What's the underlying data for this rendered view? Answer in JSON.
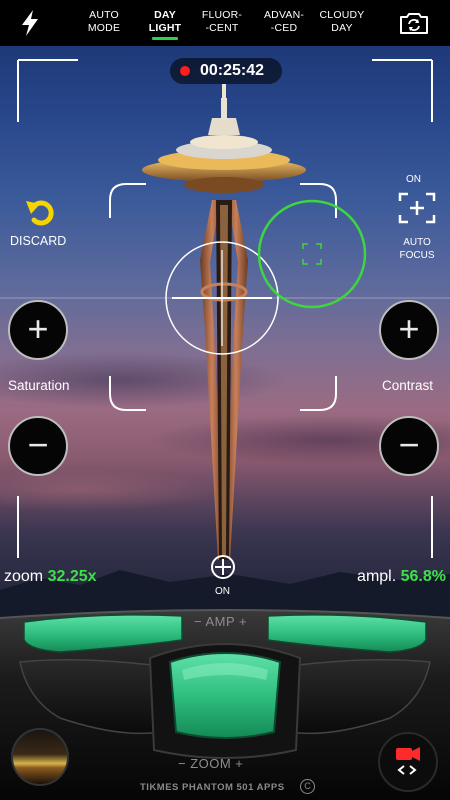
{
  "top_bar": {
    "flash_icon": "lightning-bolt-icon",
    "camera_switch_icon": "camera-switch-icon",
    "modes": [
      {
        "line1": "AUTO",
        "line2": "MODE",
        "active": false
      },
      {
        "line1": "DAY",
        "line2": "LIGHT",
        "active": true
      },
      {
        "line1": "FLUOR-",
        "line2": "-CENT",
        "active": false
      },
      {
        "line1": "ADVAN-",
        "line2": "-CED",
        "active": false
      },
      {
        "line1": "CLOUDY",
        "line2": "DAY",
        "active": false
      }
    ],
    "active_color": "#2bd24a"
  },
  "recording": {
    "timer": "00:25:42",
    "dot_color": "#ff1d1d"
  },
  "left_panel": {
    "discard_label": "DISCARD",
    "saturation_label": "Saturation",
    "plus": "+",
    "minus": "−"
  },
  "right_panel": {
    "autofocus_state": "ON",
    "autofocus_line1": "AUTO",
    "autofocus_line2": "FOCUS",
    "contrast_label": "Contrast",
    "plus": "+",
    "minus": "−"
  },
  "readouts": {
    "zoom_label": "zoom",
    "zoom_value": "32.25x",
    "ampl_label": "ampl.",
    "ampl_value": "56.8%",
    "center_state": "ON",
    "value_color": "#3ee04a"
  },
  "console": {
    "amp_label": "− AMP +",
    "zoom_label": "− ZOOM +",
    "footer": "TIKMES PHANTOM 501 APPS",
    "copyright": "C",
    "accent_color": "#2fbf7f"
  }
}
